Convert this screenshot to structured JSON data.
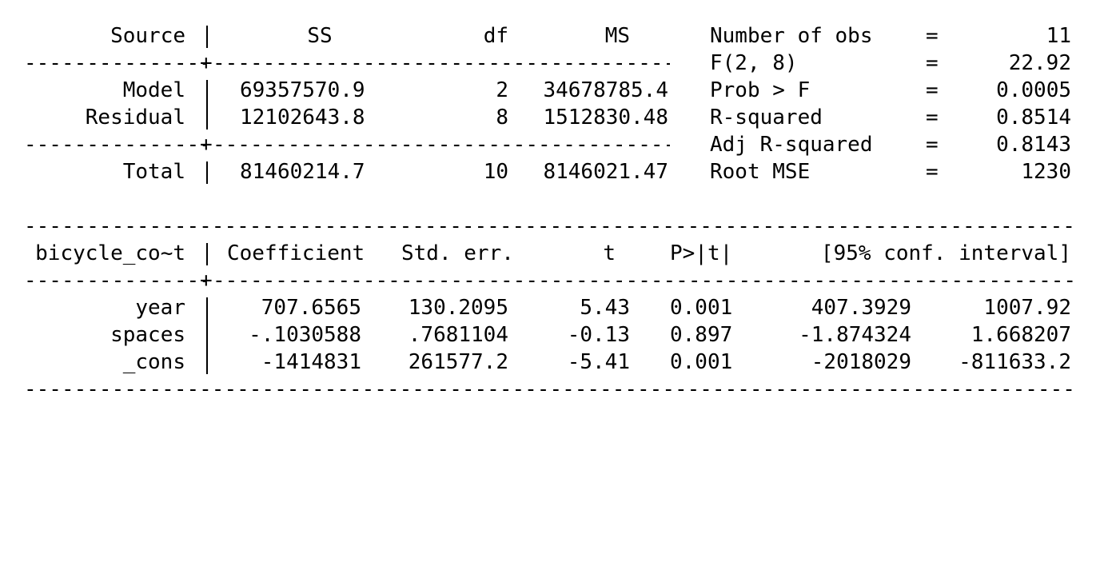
{
  "anova": {
    "header": {
      "source": "Source",
      "ss": "SS",
      "df": "df",
      "ms": "MS"
    },
    "rows": [
      {
        "source": "Model",
        "ss": "69357570.9",
        "df": "2",
        "ms": "34678785.4"
      },
      {
        "source": "Residual",
        "ss": "12102643.8",
        "df": "8",
        "ms": "1512830.48"
      }
    ],
    "total": {
      "source": "Total",
      "ss": "81460214.7",
      "df": "10",
      "ms": "8146021.47"
    }
  },
  "stats": [
    {
      "label": "Number of obs",
      "eq": "=",
      "value": "11"
    },
    {
      "label": "F(2, 8)",
      "eq": "=",
      "value": "22.92"
    },
    {
      "label": "Prob > F",
      "eq": "=",
      "value": "0.0005"
    },
    {
      "label": "R-squared",
      "eq": "=",
      "value": "0.8514"
    },
    {
      "label": "Adj R-squared",
      "eq": "=",
      "value": "0.8143"
    },
    {
      "label": "Root MSE",
      "eq": "=",
      "value": "1230"
    }
  ],
  "coef": {
    "header": {
      "depvar": "bicycle_co~t",
      "coefficient": "Coefficient",
      "stderr": "Std. err.",
      "t": "t",
      "p": "P>|t|",
      "ci": "[95% conf. interval]"
    },
    "rows": [
      {
        "var": "year",
        "coef": "707.6565",
        "se": "130.2095",
        "t": "5.43",
        "p": "0.001",
        "lo": "407.3929",
        "hi": "1007.92"
      },
      {
        "var": "spaces",
        "coef": "-.1030588",
        "se": ".7681104",
        "t": "-0.13",
        "p": "0.897",
        "lo": "-1.874324",
        "hi": "1.668207"
      },
      {
        "var": "_cons",
        "coef": "-1414831",
        "se": "261577.2",
        "t": "-5.41",
        "p": "0.001",
        "lo": "-2018029",
        "hi": "-811633.2"
      }
    ]
  }
}
